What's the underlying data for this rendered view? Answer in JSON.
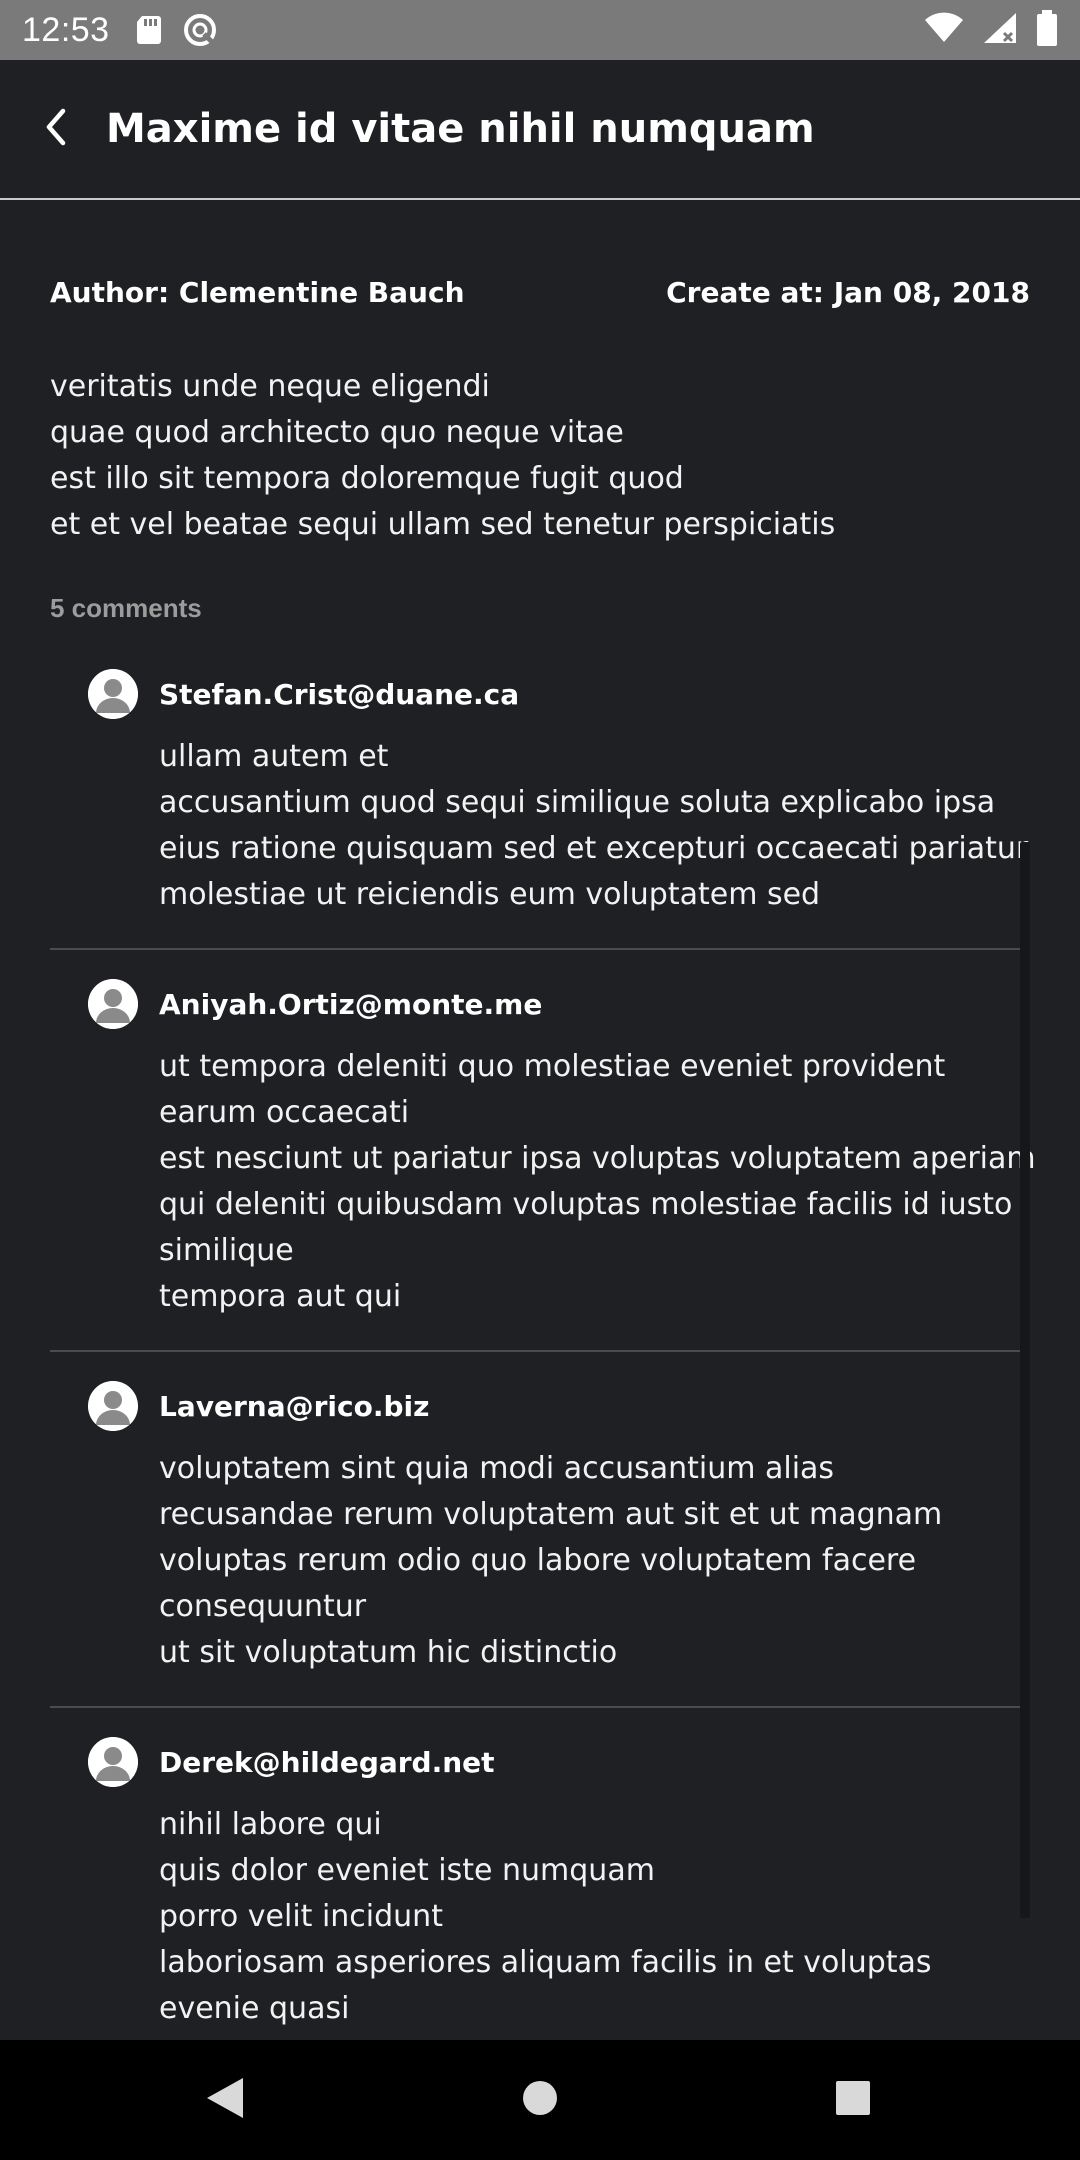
{
  "status_bar": {
    "time": "12:53",
    "icons_left": [
      "sd-card-icon",
      "data-saver-icon"
    ],
    "icons_right": [
      "wifi-icon",
      "signal-icon",
      "battery-icon"
    ]
  },
  "app_bar": {
    "back_icon": "back-arrow-icon",
    "title": "Maxime id vitae nihil numquam"
  },
  "post": {
    "author": "Author: Clementine Bauch",
    "created": "Create at: Jan 08, 2018",
    "body": "veritatis unde neque eligendi\nquae quod architecto quo neque vitae\nest illo sit tempora doloremque fugit quod\net et vel beatae sequi ullam sed tenetur perspiciatis"
  },
  "comments_header": "5 comments",
  "comments": [
    {
      "author": "Stefan.Crist@duane.ca",
      "body": "ullam autem et\naccusantium quod sequi similique soluta explicabo ipsa\neius ratione quisquam sed et excepturi occaecati pariatur\nmolestiae ut reiciendis eum voluptatem sed"
    },
    {
      "author": "Aniyah.Ortiz@monte.me",
      "body": "ut tempora deleniti quo molestiae eveniet provident earum occaecati\nest nesciunt ut pariatur ipsa voluptas voluptatem aperiam\nqui deleniti quibusdam voluptas molestiae facilis id iusto similique\ntempora aut qui"
    },
    {
      "author": "Laverna@rico.biz",
      "body": "voluptatem sint quia modi accusantium alias\nrecusandae rerum voluptatem aut sit et ut magnam\nvoluptas rerum odio quo labore voluptatem facere consequuntur\nut sit voluptatum hic distinctio"
    },
    {
      "author": "Derek@hildegard.net",
      "body": "nihil labore qui\nquis dolor eveniet iste numquam\nporro velit incidunt\nlaboriosam asperiores aliquam facilis in et voluptas evenie quasi"
    }
  ],
  "nav_bar": {
    "back_icon": "nav-back-icon",
    "home_icon": "nav-home-icon",
    "recents_icon": "nav-recents-icon"
  }
}
